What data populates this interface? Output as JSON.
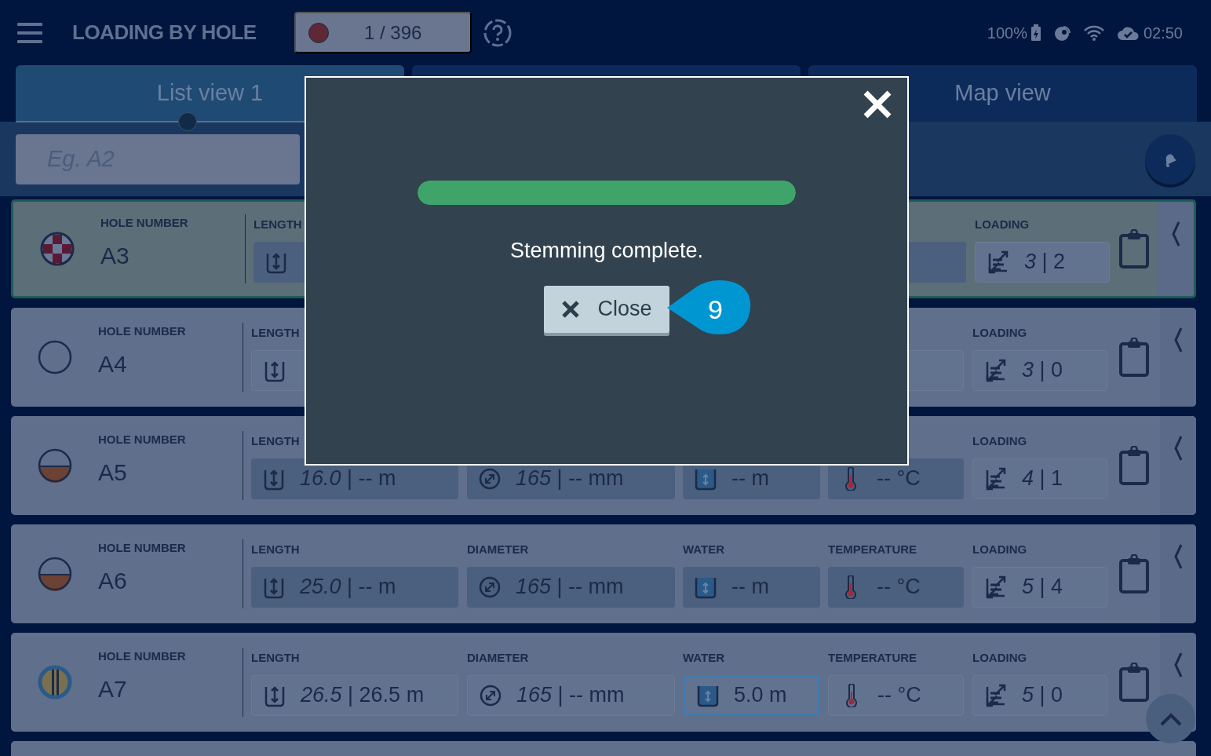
{
  "app_bar": {
    "title": "LOADING BY HOLE",
    "counter": {
      "text": "1 / 396",
      "color": "#5e2837"
    },
    "status": {
      "battery": "100%",
      "time": "02:50"
    }
  },
  "tabs": [
    {
      "label": "List view 1",
      "selected": true
    },
    {
      "selected": false
    },
    {
      "label": "Map view",
      "selected": false
    }
  ],
  "search": {
    "placeholder": "Eg. A2"
  },
  "holes": [
    {
      "label": "HOLE NUMBER",
      "number": "A3",
      "icon": {
        "kind": "checkered"
      },
      "selected": true,
      "fields": [
        {
          "kind": "length",
          "label": "LENGTH",
          "filled": true,
          "selected": false
        },
        {
          "kind": "temperature",
          "filled": true,
          "selected": false
        },
        {
          "kind": "loading",
          "label": "LOADING",
          "value": "*3* | 2",
          "filled": false,
          "selected": false
        }
      ]
    },
    {
      "label": "HOLE NUMBER",
      "number": "A4",
      "icon": {
        "kind": "empty"
      },
      "selected": false,
      "fields": [
        {
          "kind": "length",
          "label": "LENGTH",
          "filled": false,
          "selected": false
        },
        {
          "kind": "temperature",
          "filled": false,
          "selected": false
        },
        {
          "kind": "loading",
          "label": "LOADING",
          "value": "*3* | 0",
          "filled": false,
          "selected": false
        }
      ]
    },
    {
      "label": "HOLE NUMBER",
      "number": "A5",
      "icon": {
        "kind": "half"
      },
      "selected": false,
      "fields": [
        {
          "kind": "length",
          "label": "LENGTH",
          "value": "*16.0* | -- m",
          "filled": true,
          "selected": false
        },
        {
          "kind": "diameter",
          "value": "*165* | -- mm",
          "filled": true,
          "selected": false
        },
        {
          "kind": "water",
          "value": "-- m",
          "filled": true,
          "selected": false
        },
        {
          "kind": "temperature",
          "value": "-- °C",
          "filled": true,
          "selected": false
        },
        {
          "kind": "loading",
          "label": "LOADING",
          "value": "*4* | 1",
          "filled": false,
          "selected": false
        }
      ]
    },
    {
      "label": "HOLE NUMBER",
      "number": "A6",
      "icon": {
        "kind": "half"
      },
      "selected": false,
      "fields": [
        {
          "kind": "length",
          "label": "LENGTH",
          "value": "*25.0* | -- m",
          "filled": true,
          "selected": false
        },
        {
          "kind": "diameter",
          "label": "DIAMETER",
          "value": "*165* | -- mm",
          "filled": true,
          "selected": false
        },
        {
          "kind": "water",
          "label": "WATER",
          "value": "-- m",
          "filled": true,
          "selected": false
        },
        {
          "kind": "temperature",
          "label": "TEMPERATURE",
          "value": "-- °C",
          "filled": true,
          "selected": false
        },
        {
          "kind": "loading",
          "label": "LOADING",
          "value": "*5* | 4",
          "filled": false,
          "selected": false
        }
      ]
    },
    {
      "label": "HOLE NUMBER",
      "number": "A7",
      "icon": {
        "kind": "striped"
      },
      "selected": false,
      "fields": [
        {
          "kind": "length",
          "label": "LENGTH",
          "value": "*26.5* | 26.5 m",
          "filled": false,
          "selected": false
        },
        {
          "kind": "diameter",
          "label": "DIAMETER",
          "value": "*165* | -- mm",
          "filled": false,
          "selected": false
        },
        {
          "kind": "water",
          "label": "WATER",
          "value": "5.0 m",
          "filled": false,
          "selected": true
        },
        {
          "kind": "temperature",
          "label": "TEMPERATURE",
          "value": "-- °C",
          "filled": false,
          "selected": false
        },
        {
          "kind": "loading",
          "label": "LOADING",
          "value": "*5* | 0",
          "filled": false,
          "selected": false
        }
      ]
    }
  ],
  "dialog": {
    "progress": {
      "level": 1
    },
    "message": "Stemming complete.",
    "button": "Close",
    "callout": "9"
  }
}
